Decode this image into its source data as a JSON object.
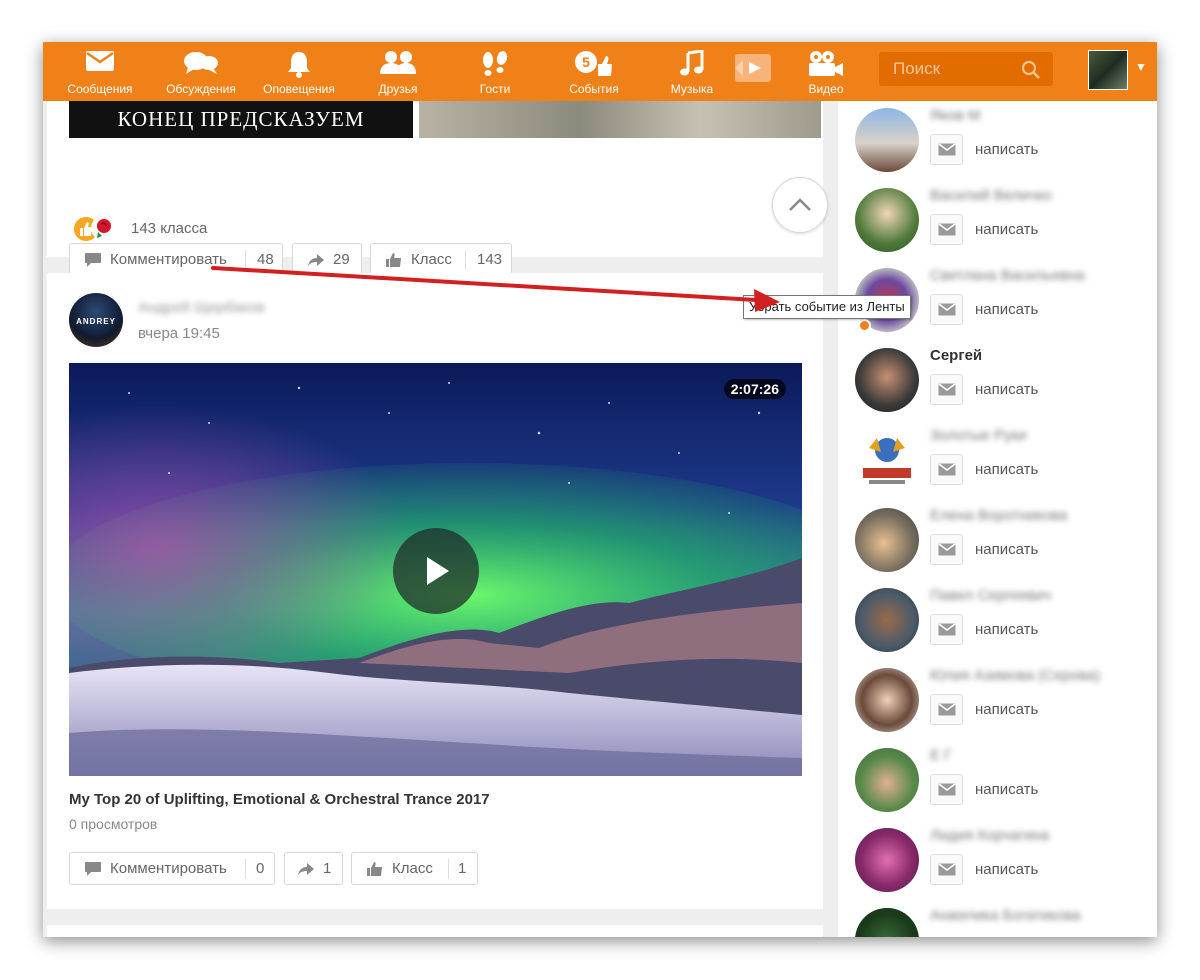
{
  "nav": {
    "items": [
      {
        "label": "Сообщения",
        "icon": "envelope-icon"
      },
      {
        "label": "Обсуждения",
        "icon": "chat-bubbles-icon"
      },
      {
        "label": "Оповещения",
        "icon": "bell-icon"
      },
      {
        "label": "Друзья",
        "icon": "friends-icon"
      },
      {
        "label": "Гости",
        "icon": "footprints-icon"
      },
      {
        "label": "События",
        "icon": "events-icon",
        "badge": "5"
      },
      {
        "label": "Музыка",
        "icon": "music-note-icon"
      },
      {
        "label": "Видео",
        "icon": "video-camera-icon"
      }
    ],
    "search_placeholder": "Поиск"
  },
  "colors": {
    "brand_orange": "#f08118",
    "search_bg": "#e36c00",
    "feed_bg": "#eeeeee",
    "arrow_red": "#d21f1f"
  },
  "prev_post": {
    "banner_text": "КОНЕЦ ПРЕДСКАЗУЕМ",
    "reactions_label": "143 класса",
    "comment_label": "Комментировать",
    "comment_count": "48",
    "share_count": "29",
    "like_label": "Класс",
    "like_count": "143"
  },
  "post": {
    "author": "Андрей Щербаков",
    "time": "вчера 19:45",
    "avatar_text": "ANDREY",
    "close_symbol": "✕",
    "close_tooltip": "Убрать событие из Ленты",
    "video_duration": "2:07:26",
    "video_title": "My Top 20 of Uplifting, Emotional & Orchestral Trance 2017",
    "views": "0 просмотров",
    "comment_label": "Комментировать",
    "comment_count": "0",
    "share_count": "1",
    "like_label": "Класс",
    "like_count": "1"
  },
  "sidebar": {
    "write_label": "написать",
    "friends": [
      {
        "name": "Яков М",
        "blurred": true
      },
      {
        "name": "Василий Величко",
        "blurred": true
      },
      {
        "name": "Светлана Васильевна",
        "blurred": true,
        "online": true
      },
      {
        "name": "Сергей",
        "blurred": false
      },
      {
        "name": "Золотые Руки",
        "blurred": true
      },
      {
        "name": "Елена Воротникова",
        "blurred": true
      },
      {
        "name": "Павел Сергеевич",
        "blurred": true
      },
      {
        "name": "Юлия Азимова (Серова)",
        "blurred": true
      },
      {
        "name": "Е Г",
        "blurred": true
      },
      {
        "name": "Лидия Корчагина",
        "blurred": true
      },
      {
        "name": "Анжелика Богатикова",
        "blurred": true
      }
    ]
  }
}
